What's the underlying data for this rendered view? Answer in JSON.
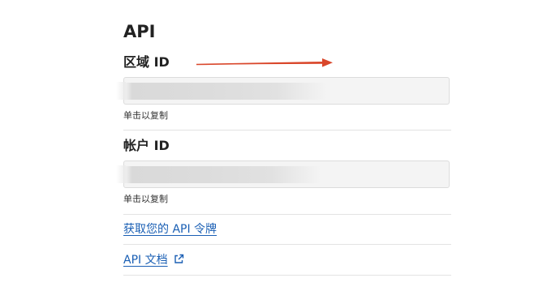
{
  "section": {
    "title": "API"
  },
  "region_id": {
    "label": "区域 ID",
    "value": "",
    "hint": "单击以复制"
  },
  "account_id": {
    "label": "帐户 ID",
    "value": "",
    "hint": "单击以复制"
  },
  "links": {
    "get_token": "获取您的 API 令牌",
    "docs": "API 文档"
  },
  "colors": {
    "link": "#1a5fb4",
    "annotation_arrow": "#d9472b",
    "field_bg": "#f4f4f4"
  },
  "icons": {
    "external": "external-link-icon",
    "annotation": "arrow-right-annotation"
  }
}
